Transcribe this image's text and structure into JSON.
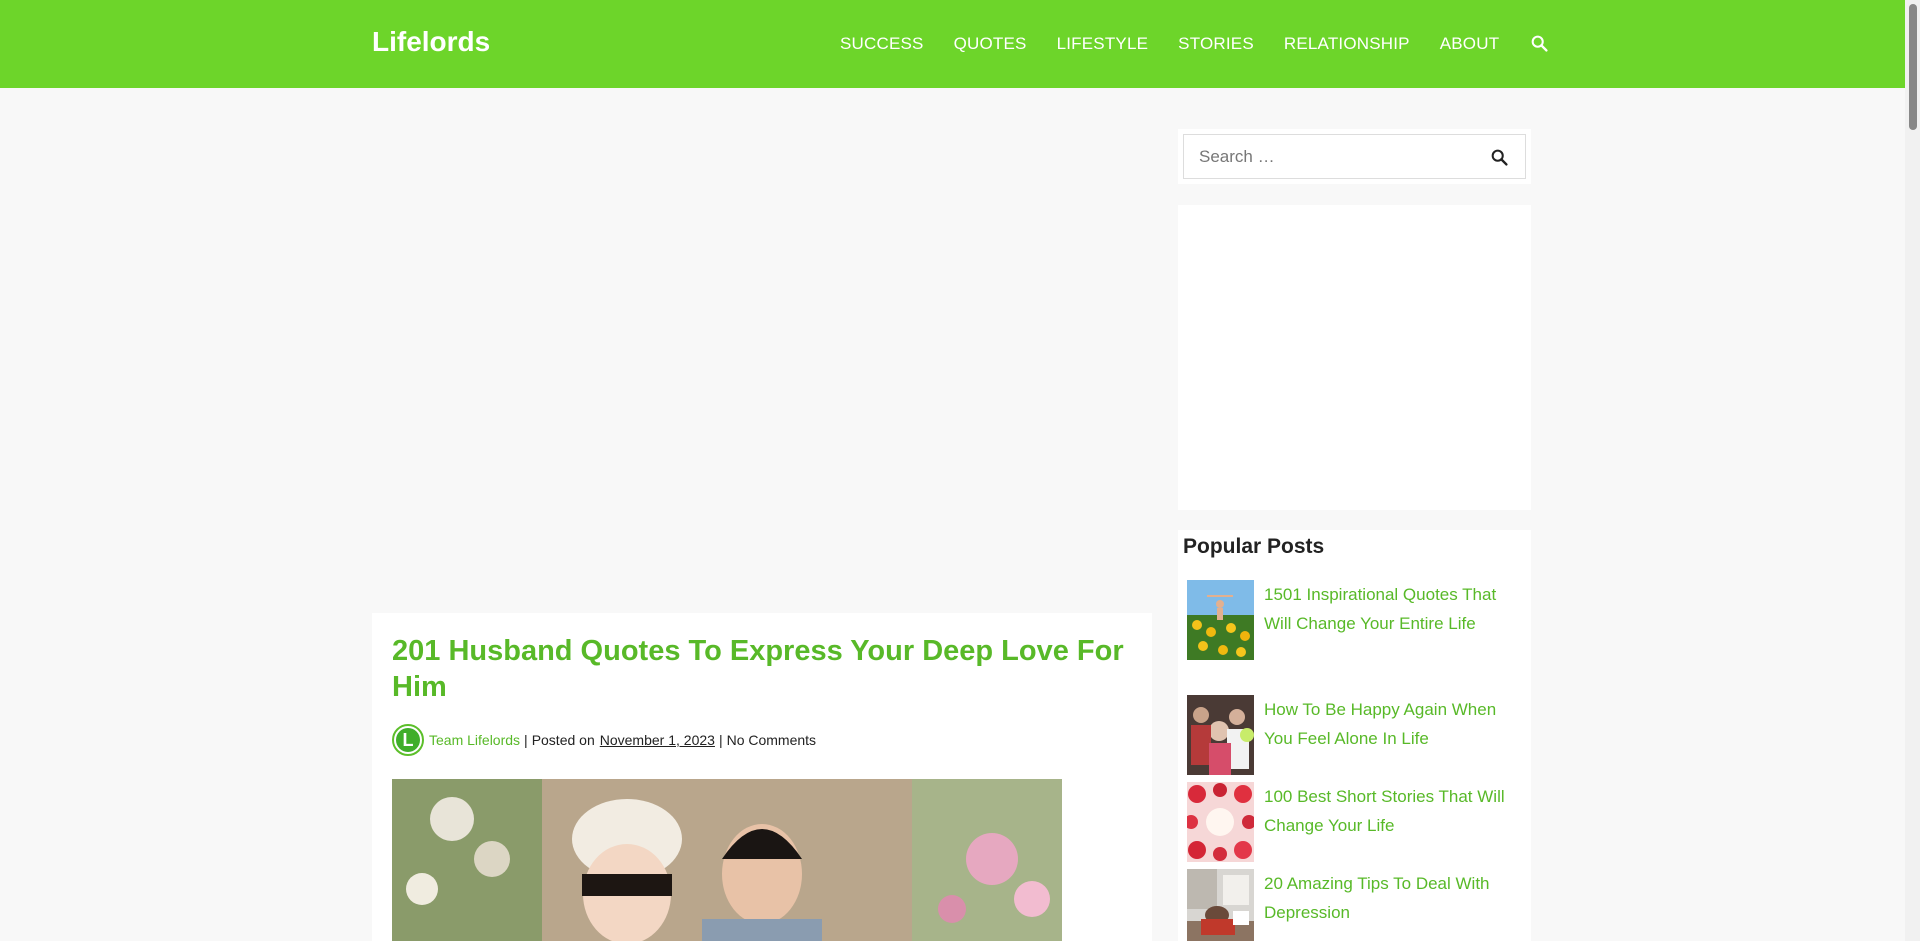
{
  "header": {
    "logo": "Lifelords",
    "nav": [
      "SUCCESS",
      "QUOTES",
      "LIFESTYLE",
      "STORIES",
      "RELATIONSHIP",
      "ABOUT"
    ],
    "search_icon": "search-icon"
  },
  "article": {
    "title": "201 Husband Quotes To Express Your Deep Love For Him",
    "avatar_letter": "L",
    "author": "Team Lifelords",
    "posted_label": "Posted on",
    "date": "November 1, 2023",
    "comments": "No Comments",
    "separator": "|"
  },
  "sidebar": {
    "search_placeholder": "Search …",
    "popular_title": "Popular Posts",
    "posts": [
      {
        "title": "1501 Inspirational Quotes That Will Change Your Entire Life"
      },
      {
        "title": "How To Be Happy Again When You Feel Alone In Life"
      },
      {
        "title": "100 Best Short Stories That Will Change Your Life"
      },
      {
        "title": "20 Amazing Tips To Deal With Depression"
      }
    ]
  },
  "colors": {
    "brand": "#6dd52a",
    "link": "#58b928"
  }
}
